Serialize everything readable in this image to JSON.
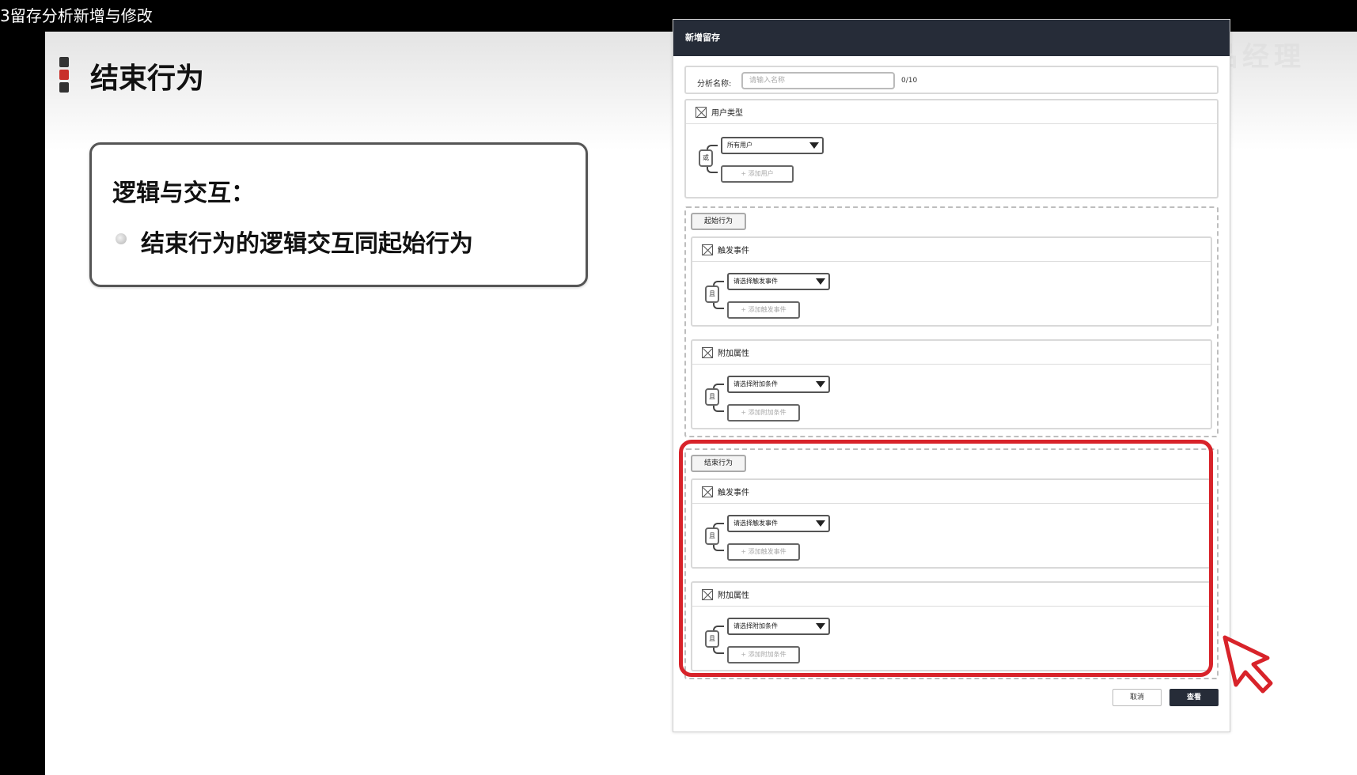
{
  "window": {
    "title": "3留存分析新增与修改"
  },
  "slide": {
    "title": "结束行为",
    "callout": {
      "heading": "逻辑与交互：",
      "bullet": "结束行为的逻辑交互同起始行为"
    }
  },
  "watermark": "黑马产品经理",
  "colors": {
    "accent": "#c8302a",
    "header": "#262c38",
    "highlight": "#d8232a"
  },
  "mock": {
    "header_title": "新增留存",
    "name_label": "分析名称:",
    "name_placeholder": "请输入名称",
    "name_count": "0/10",
    "user_type": {
      "title": "用户类型",
      "connector": "或",
      "select": "所有用户",
      "add": "+ 添加用户"
    },
    "start_behavior": {
      "tag": "起始行为",
      "trigger": {
        "title": "触发事件",
        "connector": "且",
        "select": "请选择触发事件",
        "add": "+ 添加触发事件"
      },
      "attr": {
        "title": "附加属性",
        "connector": "且",
        "select": "请选择附加条件",
        "add": "+ 添加附加条件"
      }
    },
    "end_behavior": {
      "tag": "结束行为",
      "trigger": {
        "title": "触发事件",
        "connector": "且",
        "select": "请选择触发事件",
        "add": "+ 添加触发事件"
      },
      "attr": {
        "title": "附加属性",
        "connector": "且",
        "select": "请选择附加条件",
        "add": "+ 添加附加条件"
      }
    },
    "cancel_button": "取消",
    "view_button": "查看"
  }
}
